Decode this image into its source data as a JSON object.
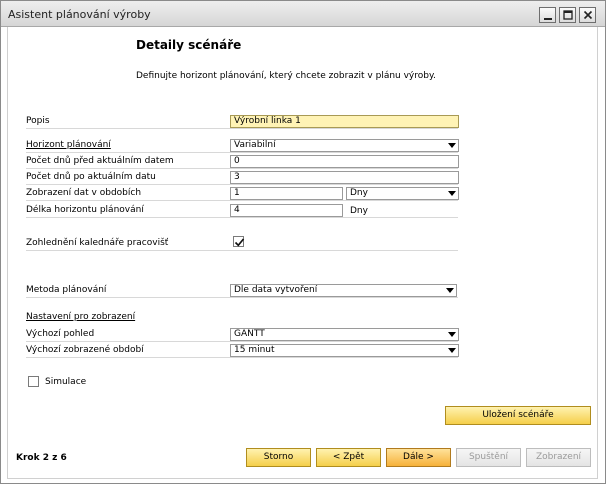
{
  "window": {
    "title": "Asistent plánování výroby"
  },
  "header": {
    "heading": "Detaily scénáře",
    "intro": "Definujte horizont plánování, který chcete zobrazit v plánu výroby."
  },
  "form": {
    "popis": {
      "label": "Popis",
      "value": "Výrobní linka 1"
    },
    "horizont": {
      "label": "Horizont plánování",
      "value": "Variabilní"
    },
    "days_before": {
      "label": "Počet dnů před aktuálním datem",
      "value": "0"
    },
    "days_after": {
      "label": "Počet dnů po aktuálním datu",
      "value": "3"
    },
    "periods": {
      "label": "Zobrazení dat v obdobích",
      "value": "1",
      "unit_value": "Dny"
    },
    "length": {
      "label": "Délka horizontu plánování",
      "value": "4",
      "unit": "Dny"
    },
    "calendar": {
      "label": "Zohlednění kalednáře pracovišť",
      "checked": true
    },
    "method": {
      "label": "Metoda plánování",
      "value": "Dle data vytvoření"
    },
    "display_section": {
      "label": "Nastavení pro zobrazení"
    },
    "default_view": {
      "label": "Výchozí pohled",
      "value": "GANTT"
    },
    "default_period": {
      "label": "Výchozí zobrazené období",
      "value": "15 minut"
    },
    "simulation": {
      "label": "Simulace",
      "checked": false
    }
  },
  "buttons": {
    "save_scenario": "Uložení scénáře",
    "cancel": "Storno",
    "back": "< Zpět",
    "next": "Dále >",
    "run": "Spuštění",
    "display": "Zobrazení"
  },
  "footer": {
    "step": "Krok 2 z 6"
  }
}
